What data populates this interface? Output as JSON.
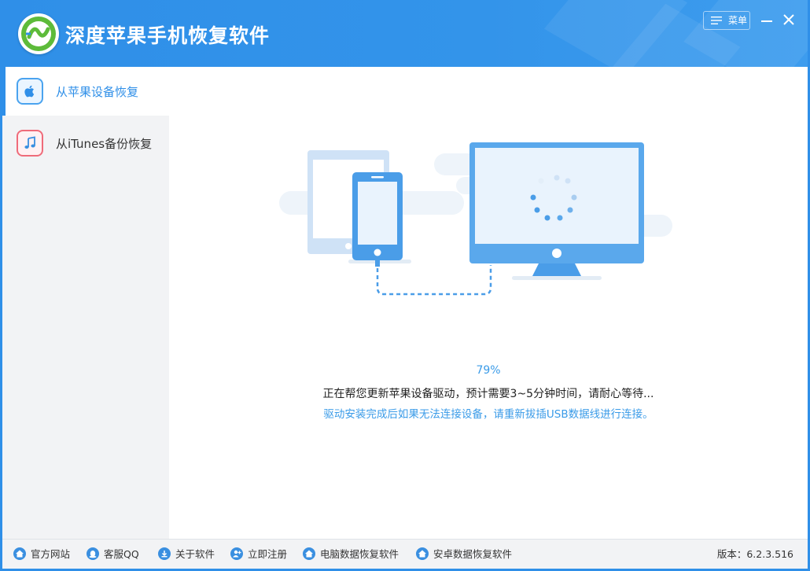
{
  "app": {
    "title": "深度苹果手机恢复软件",
    "menu_label": "菜单",
    "accent_color": "#2f8fe8"
  },
  "sidebar": {
    "items": [
      {
        "label": "从苹果设备恢复",
        "icon": "apple-icon",
        "active": true
      },
      {
        "label": "从iTunes备份恢复",
        "icon": "music-note-icon",
        "active": false
      }
    ]
  },
  "main": {
    "illustration": [
      "tablet-icon",
      "phone-icon",
      "monitor-icon",
      "loading-spinner"
    ],
    "progress_text": "79%",
    "progress_value": 0.79,
    "status_text": "正在帮您更新苹果设备驱动，预计需要3~5分钟时间，请耐心等待...",
    "hint_text": "驱动安装完成后如果无法连接设备，请重新拔插USB数据线进行连接。"
  },
  "footer": {
    "links": [
      {
        "label": "官方网站",
        "icon": "home-icon"
      },
      {
        "label": "客服QQ",
        "icon": "qq-icon"
      },
      {
        "label": "关于软件",
        "icon": "download-icon"
      },
      {
        "label": "立即注册",
        "icon": "user-add-icon"
      },
      {
        "label": "电脑数据恢复软件",
        "icon": "home-icon"
      },
      {
        "label": "安卓数据恢复软件",
        "icon": "home-icon"
      }
    ],
    "version": "版本：6.2.3.516"
  }
}
